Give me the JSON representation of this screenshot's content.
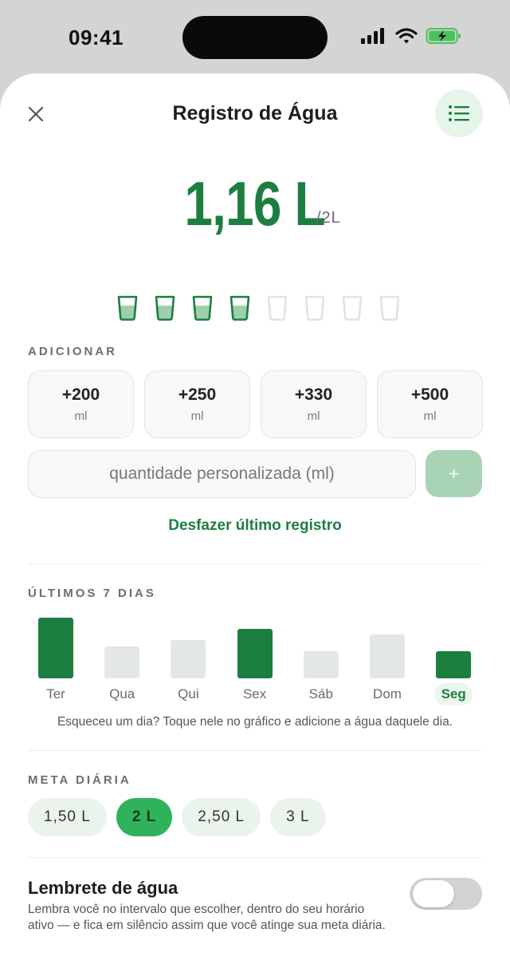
{
  "status": {
    "time": "09:41"
  },
  "header": {
    "title": "Registro de Água"
  },
  "intake": {
    "current": "1,16 L",
    "goal": "/2L"
  },
  "cups": {
    "total": 8,
    "filled": 4,
    "colors": {
      "filled_stroke": "#1c7f3f",
      "filled_water": "#9ccfaa",
      "empty_stroke": "#e2e2e2"
    }
  },
  "add_section": {
    "label": "ADICIONAR",
    "options": [
      {
        "amount": "+200",
        "unit": "ml"
      },
      {
        "amount": "+250",
        "unit": "ml"
      },
      {
        "amount": "+330",
        "unit": "ml"
      },
      {
        "amount": "+500",
        "unit": "ml"
      }
    ],
    "custom_placeholder": "quantidade personalizada (ml)",
    "custom_button": "+",
    "undo_label": "Desfazer último registro"
  },
  "history": {
    "label": "ÚLTIMOS 7 DIAS",
    "hint": "Esqueceu um dia? Toque nele no gráfico e adicione a água daquele dia."
  },
  "chart_data": {
    "type": "bar",
    "categories": [
      "Ter",
      "Qua",
      "Qui",
      "Sex",
      "Sáb",
      "Dom",
      "Seg"
    ],
    "values": [
      1.0,
      0.53,
      0.63,
      0.82,
      0.45,
      0.73,
      0.45
    ],
    "goal_met": [
      true,
      false,
      false,
      true,
      false,
      false,
      true
    ],
    "active_category": "Seg",
    "colors": {
      "met": "#1c7f3f",
      "unmet": "#e3e8e4"
    }
  },
  "daily_goal": {
    "label": "META DIÁRIA",
    "options": [
      "1,50 L",
      "2 L",
      "2,50 L",
      "3 L"
    ],
    "selected": "2 L"
  },
  "reminder": {
    "title": "Lembrete de água",
    "description": "Lembra você no intervalo que escolher, dentro do seu horário ativo — e fica em silêncio assim que você atinge sua meta diária.",
    "enabled": false
  }
}
